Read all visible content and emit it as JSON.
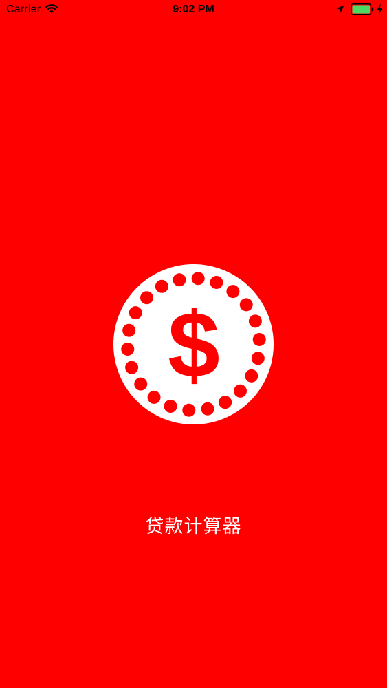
{
  "status_bar": {
    "carrier": "Carrier",
    "time": "9:02 PM",
    "icons": [
      "wifi-icon",
      "location-arrow-icon",
      "battery-icon",
      "charging-bolt-icon"
    ],
    "battery_color": "#4cd964"
  },
  "splash": {
    "background_color": "#ff0000",
    "logo_icon": "dollar-coin-icon",
    "logo_symbol": "$",
    "app_name": "贷款计算器"
  }
}
